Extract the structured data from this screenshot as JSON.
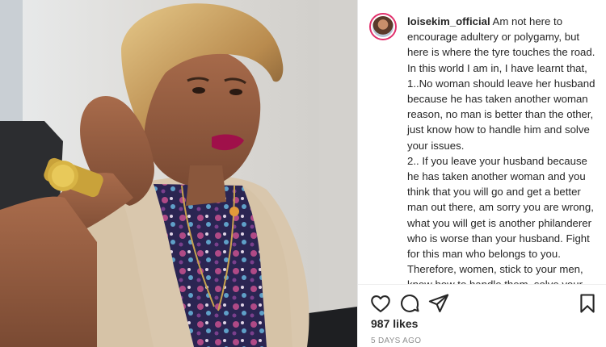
{
  "post": {
    "username": "loisekim_official",
    "caption": "Am not here to encourage adultery or polygamy, but here is where the tyre touches the road. In this world I am in, I have learnt that,\n1..No woman should leave her husband because he has taken another woman reason, no man is better than the other, just know how to handle him and solve your issues.\n2.. If you leave your husband because he has taken another woman and you think that you will go and get a better man out there, am sorry you are wrong, what you will get is another philanderer who is worse than your husband. Fight for this man who belongs to you. Therefore, women, stick to your men, know how to handle them, solve your",
    "likes": "987 likes",
    "timestamp": "5 DAYS AGO"
  },
  "icons": {
    "like": "heart-icon",
    "comment": "comment-icon",
    "share": "share-icon",
    "save": "bookmark-icon"
  },
  "colors": {
    "story_ring": "#e1306c",
    "text": "#262626",
    "muted": "#8e8e8e"
  }
}
